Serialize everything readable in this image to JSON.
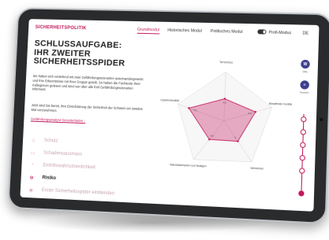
{
  "nav": {
    "brand": "SICHERHEITSPOLITIK",
    "tabs": [
      {
        "label": "Grundmodul",
        "active": true
      },
      {
        "label": "Historisches Modul",
        "active": false
      },
      {
        "label": "Politisches Modul",
        "active": false
      }
    ],
    "toggle_label": "Profi-Modus",
    "language": "DE"
  },
  "main": {
    "title_line1": "SCHLUSSAUFGABE:",
    "title_line2": "IHR ZWEITER",
    "title_line3": "SICHERHEITSSPIDER",
    "paragraph1": "Sie haben sich vertiefend mit zwei Gefährdungsszenarien auseinandergesetzt und Ihre Erkenntnisse mit Ihrer Gruppe geteilt. So haben die Fachtexte Ihrer Kolleginnen gelesen und sind nun über alle fünf Gefährdungsszenarien informiert.",
    "paragraph2": "Jetzt sind Sie bereit, Ihre Einschätzung der Sicherheit der Schweiz ein zweites Mal vorzunehmen.",
    "link_label": "Gefährdungsanalyse herunterladen ↓"
  },
  "menu": [
    {
      "label": "Schutz",
      "icon": "shield-icon",
      "glyph": "◇",
      "active": false
    },
    {
      "label": "Schadensausmass",
      "icon": "damage-icon",
      "glyph": "▭",
      "active": false
    },
    {
      "label": "Eintrittswahrscheinlichkeit",
      "icon": "probability-icon",
      "glyph": "◔",
      "active": false
    },
    {
      "label": "Risiko",
      "icon": "risk-icon",
      "glyph": "⊖",
      "active": true
    },
    {
      "label": "Erster Sicherheitsspider einblenden",
      "icon": "eye-icon",
      "glyph": "◉",
      "active": false
    }
  ],
  "chart_data": {
    "type": "radar",
    "axes": [
      "Terrorismus",
      "Bewaffneter Konflikt",
      "Verbrechen",
      "Naturkatastrophen und Notlagen",
      "Cyberkriminalität"
    ],
    "max": 10,
    "rings": [
      2,
      4,
      6,
      8,
      10
    ],
    "series": [
      {
        "values": [
          4.5,
          6.6,
          5,
          4.8,
          7.6
        ],
        "color": "#c2185b"
      }
    ],
    "value_labels": [
      "4.5",
      "6.6",
      "5",
      "4.8",
      "7.6"
    ]
  },
  "sidebar": {
    "buttons": [
      {
        "glyph": "W",
        "label": "Hilfe"
      },
      {
        "glyph": "≡",
        "label": "Fazitinfo"
      }
    ]
  },
  "colors": {
    "accent": "#c2185b",
    "accent_light": "#e3a6c1",
    "button_bg": "#3d3f8e",
    "device_frame": "#2a2b2d"
  }
}
